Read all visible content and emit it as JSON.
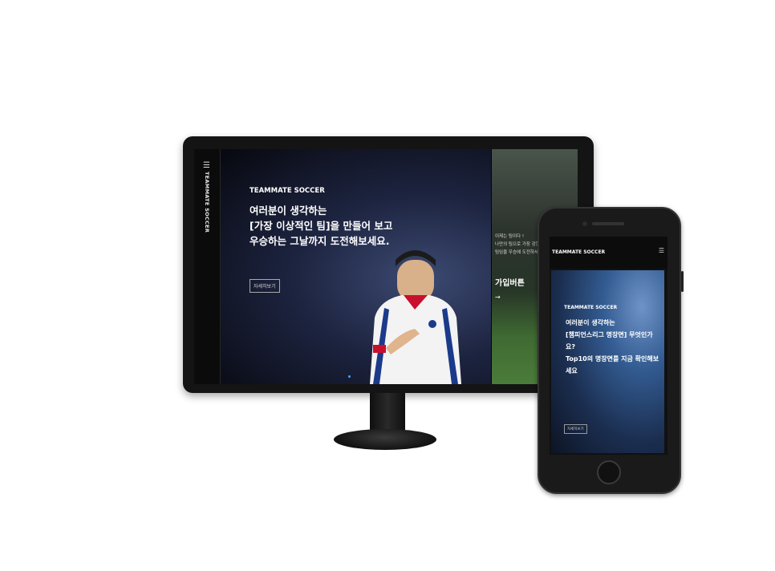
{
  "desktop": {
    "vertical_brand": "TEAMMATE SOCCER",
    "menu_icon": "hamburger-icon",
    "brand": "TEAMMATE SOCCER",
    "headline_lines": [
      "여러분이 생각하는",
      "[가장 이상적인 팀]을 만들어 보고",
      "우승하는 그날까지 도전해보세요."
    ],
    "cta_label": "자세히보기",
    "side_panel": {
      "lines": [
        "이제는 팀이다 !",
        "나만의 팀으로 가장 강한",
        "팀임을 우승에 도전하세요"
      ],
      "join_label": "가입버튼",
      "arrow": "→"
    }
  },
  "mobile": {
    "brand": "TEAMMATE SOCCER",
    "menu_icon": "hamburger-icon",
    "hero_brand": "TEAMMATE SOCCER",
    "headline_lines": [
      "여러분이 생각하는",
      "[챔피언스리그 명장면] 무엇인가",
      "요?",
      "Top10의 명장면를 지금 확인해보",
      "세요"
    ],
    "cta_label": "자세히보기"
  },
  "colors": {
    "hero_blue": "#1d2440",
    "jersey_red": "#c8102e",
    "pitch_green": "#4b7c3b",
    "phone_blue": "#335c92"
  }
}
